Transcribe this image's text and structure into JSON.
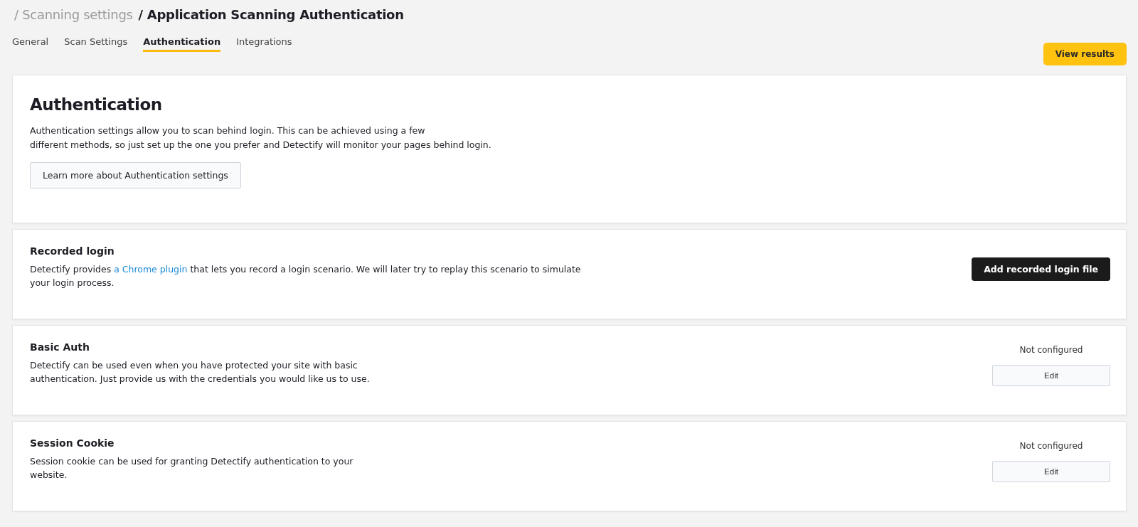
{
  "breadcrumb": {
    "parent": "/ Scanning settings",
    "current": "/ Application Scanning Authentication"
  },
  "tabs": [
    {
      "label": "General",
      "selected": false
    },
    {
      "label": "Scan Settings",
      "selected": false
    },
    {
      "label": "Authentication",
      "selected": true
    },
    {
      "label": "Integrations",
      "selected": false
    }
  ],
  "view_results_button": "View results",
  "intro": {
    "title": "Authentication",
    "lines": [
      "Authentication settings allow you to scan behind login. This can be achieved using a few",
      "different methods, so just set up the one you prefer and Detectify will monitor your pages behind login."
    ],
    "button": "Learn more about Authentication settings"
  },
  "sections": [
    {
      "kind": "action",
      "title": "Recorded login",
      "text_before": "Detectify provides ",
      "link": "a Chrome plugin",
      "text_after": " that lets you record a login scenario. We will later try to replay this scenario to simulate your login process.",
      "button": "Add recorded login file"
    },
    {
      "kind": "status",
      "title": "Basic Auth",
      "text_before": "Detectify can be used even when you have protected your site with basic authentication. Just provide us with the credentials you would like us to use.",
      "status": "Not configured",
      "button": "Edit"
    },
    {
      "kind": "status",
      "title": "Session Cookie",
      "text_before": "Session cookie can be used for granting Detectify authentication to your website.",
      "status": "Not configured",
      "button": "Edit"
    }
  ]
}
